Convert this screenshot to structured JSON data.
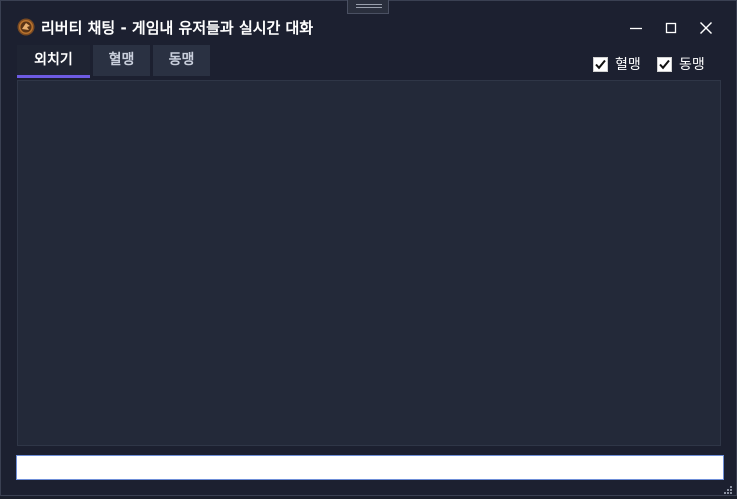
{
  "window": {
    "title": "리버티 채팅 - 게임내 유저들과 실시간 대화",
    "app_icon": "liberty-logo-icon"
  },
  "controls": {
    "minimize_icon": "minimize-icon",
    "maximize_icon": "maximize-icon",
    "close_icon": "close-icon"
  },
  "tabs": [
    {
      "label": "외치기",
      "active": true
    },
    {
      "label": "혈맹",
      "active": false
    },
    {
      "label": "동맹",
      "active": false
    }
  ],
  "filters": [
    {
      "label": "혈맹",
      "checked": true
    },
    {
      "label": "동맹",
      "checked": true
    }
  ],
  "chat_input": {
    "value": "",
    "placeholder": ""
  },
  "colors": {
    "window_bg": "#1c2030",
    "chat_bg": "#232939",
    "tab_bg": "#2a3142",
    "active_tab_underline": "#6d5be3",
    "input_border": "#6f8fd8"
  }
}
